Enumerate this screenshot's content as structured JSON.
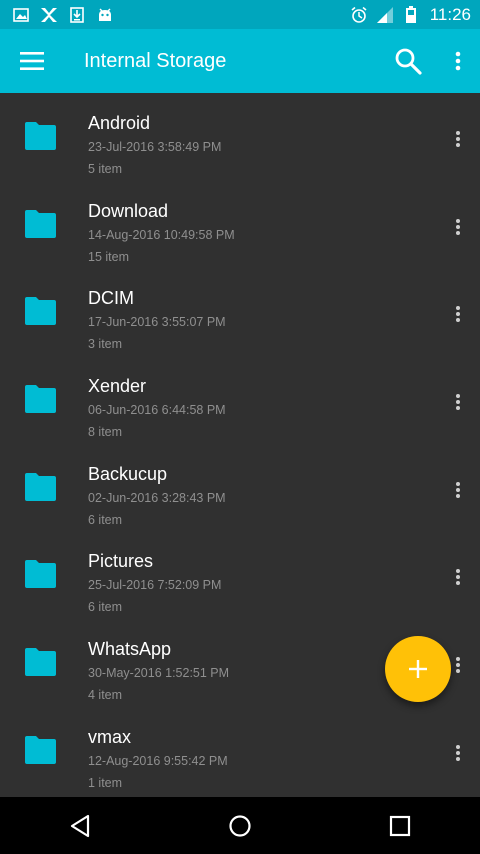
{
  "status_bar": {
    "time": "11:26",
    "left_icons": [
      "image-icon",
      "xender-icon",
      "download-icon",
      "android-icon"
    ],
    "right_icons": [
      "alarm-icon",
      "signal-icon",
      "battery-icon"
    ]
  },
  "toolbar": {
    "title": "Internal Storage",
    "background": "#00bcd4"
  },
  "files": [
    {
      "name": "Android",
      "date": "23-Jul-2016 3:58:49 PM",
      "count": "5 item"
    },
    {
      "name": "Download",
      "date": "14-Aug-2016 10:49:58 PM",
      "count": "15 item"
    },
    {
      "name": "DCIM",
      "date": "17-Jun-2016 3:55:07 PM",
      "count": "3 item"
    },
    {
      "name": "Xender",
      "date": "06-Jun-2016 6:44:58 PM",
      "count": "8 item"
    },
    {
      "name": "Backucup",
      "date": "02-Jun-2016 3:28:43 PM",
      "count": "6 item"
    },
    {
      "name": "Pictures",
      "date": "25-Jul-2016 7:52:09 PM",
      "count": "6 item"
    },
    {
      "name": "WhatsApp",
      "date": "30-May-2016 1:52:51 PM",
      "count": "4 item"
    },
    {
      "name": "vmax",
      "date": "12-Aug-2016 9:55:42 PM",
      "count": "1 item"
    }
  ],
  "fab": {
    "icon": "plus-icon",
    "color": "#ffc107"
  },
  "nav_bar": {
    "icons": [
      "back-icon",
      "home-icon",
      "recents-icon"
    ]
  },
  "colors": {
    "folder": "#00bcd4",
    "background": "#303030",
    "status_bar": "#00a6bd"
  }
}
